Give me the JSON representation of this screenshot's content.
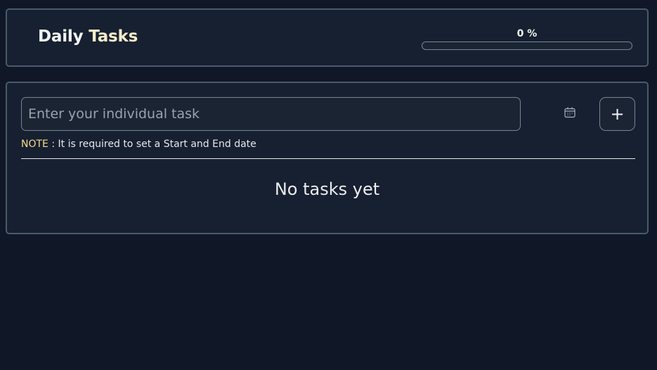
{
  "header": {
    "title_word": "Daily",
    "title_accent": "Tasks",
    "progress_label": "0 %",
    "progress_percent": 0
  },
  "task_form": {
    "input_value": "",
    "input_placeholder": "Enter your individual task",
    "add_button_label": "+",
    "calendar_icon": "calendar-icon",
    "note_key": "NOTE",
    "note_text": " : It is required to set a Start and End date"
  },
  "task_list": {
    "empty_text": "No tasks yet",
    "items": []
  },
  "colors": {
    "background": "#101827",
    "card": "#162031",
    "border": "#4a5a6d",
    "accent": "#f6ecc9",
    "note_key": "#f6d98a"
  }
}
